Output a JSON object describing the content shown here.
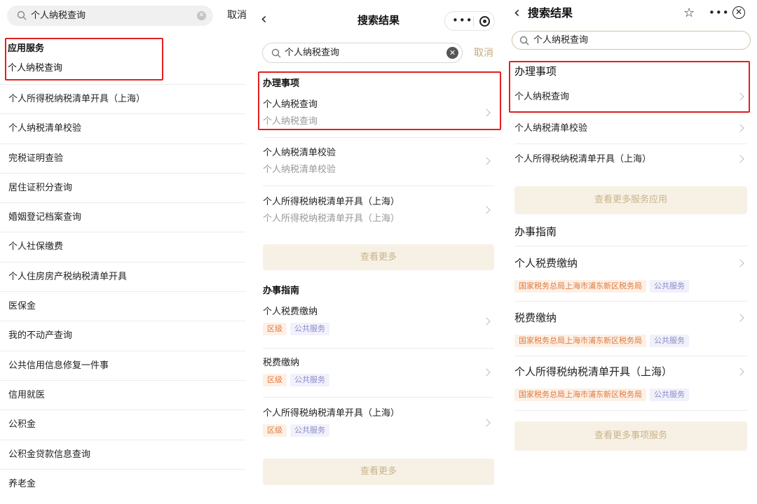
{
  "left_screen": {
    "search": {
      "query": "个人纳税查询",
      "cancel_label": "取消"
    },
    "section_title": "应用服务",
    "first_item": "个人纳税查询",
    "items": [
      "个人所得税纳税清单开具（上海）",
      "个人纳税清单校验",
      "完税证明查验",
      "居住证积分查询",
      "婚姻登记档案查询",
      "个人社保缴费",
      "个人住房房产税纳税清单开具",
      "医保金",
      "我的不动产查询",
      "公共信用信息修复一件事",
      "信用就医",
      "公积金",
      "公积金贷款信息查询",
      "养老金"
    ]
  },
  "middle_screen": {
    "nav": {
      "back_icon": "chevron-left-icon",
      "title": "搜索结果"
    },
    "search": {
      "query": "个人纳税查询",
      "cancel_label": "取消"
    },
    "matters": {
      "title": "办理事项",
      "items": [
        {
          "title": "个人纳税查询",
          "subtitle": "个人纳税查询"
        },
        {
          "title": "个人纳税清单校验",
          "subtitle": "个人纳税清单校验"
        },
        {
          "title": "个人所得税纳税清单开具（上海）",
          "subtitle": "个人所得税纳税清单开具（上海）"
        }
      ],
      "more_label": "查看更多"
    },
    "guides": {
      "title": "办事指南",
      "items": [
        {
          "title": "个人税费缴纳",
          "tags": [
            "区级",
            "公共服务"
          ]
        },
        {
          "title": "税费缴纳",
          "tags": [
            "区级",
            "公共服务"
          ]
        },
        {
          "title": "个人所得税纳税清单开具（上海）",
          "tags": [
            "区级",
            "公共服务"
          ]
        }
      ],
      "more_label": "查看更多"
    }
  },
  "right_screen": {
    "nav": {
      "title": "搜索结果"
    },
    "search": {
      "query": "个人纳税查询"
    },
    "matters": {
      "title": "办理事项",
      "items": [
        "个人纳税查询",
        "个人纳税清单校验",
        "个人所得税纳税清单开具（上海）"
      ],
      "more_label": "查看更多服务应用"
    },
    "guides": {
      "title": "办事指南",
      "items": [
        {
          "title": "个人税费缴纳",
          "tags": [
            "国家税务总局上海市浦东新区税务局",
            "公共服务"
          ]
        },
        {
          "title": "税费缴纳",
          "tags": [
            "国家税务总局上海市浦东新区税务局",
            "公共服务"
          ]
        },
        {
          "title": "个人所得税纳税清单开具（上海）",
          "tags": [
            "国家税务总局上海市浦东新区税务局",
            "公共服务"
          ]
        }
      ],
      "more_label": "查看更多事项服务"
    }
  },
  "colors": {
    "highlight_box": "#e02020",
    "accent_gold": "#c9b38a",
    "button_bg": "#f7f1e5",
    "tag_orange": "#e07a3f",
    "tag_purple": "#8d8cc9"
  }
}
